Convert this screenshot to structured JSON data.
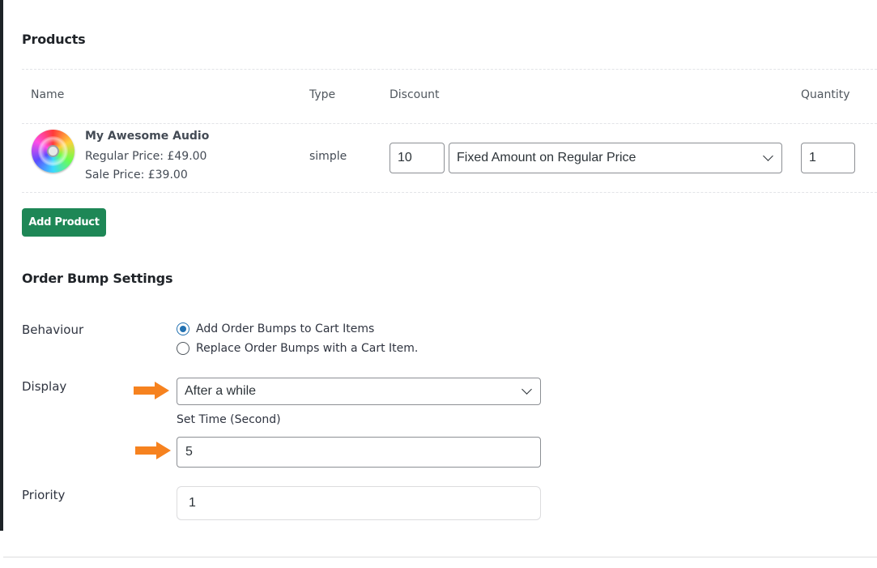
{
  "products": {
    "section_title": "Products",
    "columns": {
      "name": "Name",
      "type": "Type",
      "discount": "Discount",
      "quantity": "Quantity"
    },
    "row": {
      "icon": "cd-disc-icon",
      "name": "My Awesome Audio",
      "regular_price": "Regular Price: £49.00",
      "sale_price": "Sale Price: £39.00",
      "type": "simple",
      "discount_value": "10",
      "discount_type": "Fixed Amount on Regular Price",
      "quantity": "1"
    },
    "add_button": "Add Product"
  },
  "order_bump": {
    "section_title": "Order Bump Settings",
    "behaviour_label": "Behaviour",
    "behaviour_options": [
      {
        "label": "Add Order Bumps to Cart Items",
        "checked": true
      },
      {
        "label": "Replace Order Bumps with a Cart Item.",
        "checked": false
      }
    ],
    "display_label": "Display",
    "display_value": "After a while",
    "set_time_label": "Set Time (Second)",
    "set_time_value": "5",
    "priority_label": "Priority",
    "priority_value": "1"
  },
  "annotation_color": "#f6821f",
  "accent_color": "#1e8756",
  "radio_color": "#2271b1"
}
